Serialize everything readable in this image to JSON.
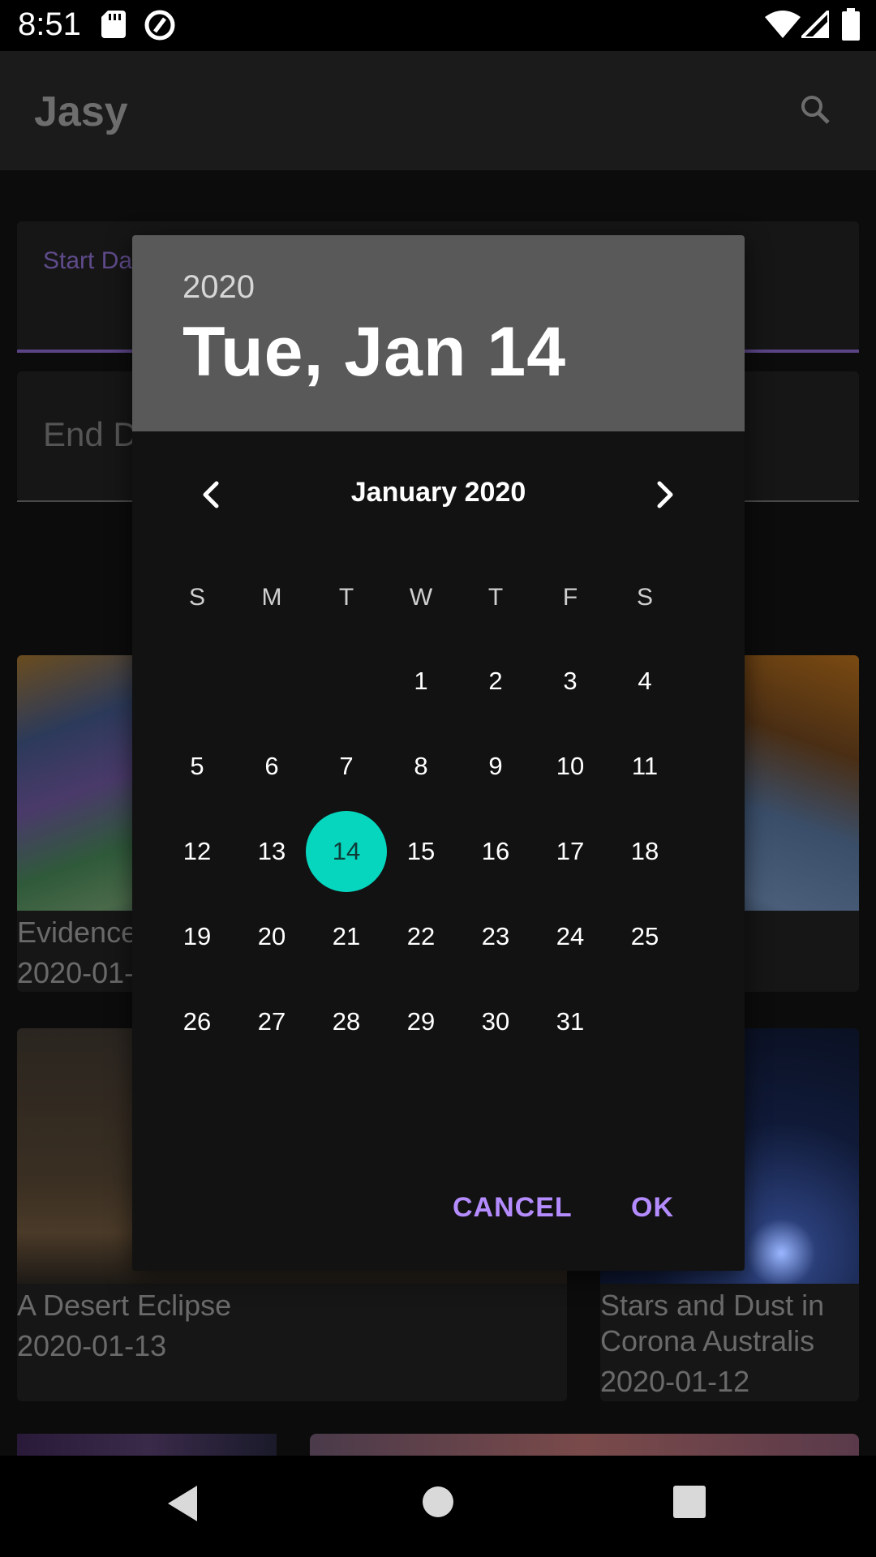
{
  "status_bar": {
    "time": "8:51",
    "icons": [
      "sd-card-icon",
      "data-saver-icon",
      "wifi-icon",
      "cell-signal-icon",
      "battery-icon"
    ]
  },
  "app_bar": {
    "title": "Jasy",
    "search_icon": "search-icon"
  },
  "background": {
    "start_date_label": "Start Da",
    "end_date_placeholder": "End D",
    "cards": [
      {
        "title": "Evidence",
        "date": "2020-01-"
      },
      {
        "title": "A Desert Eclipse",
        "date": "2020-01-13"
      },
      {
        "title": "Stars and Dust in Corona Australis",
        "title_line1": "Stars and Dust in",
        "title_line2": "Corona Australis",
        "date": "2020-01-12"
      }
    ]
  },
  "date_picker": {
    "header_year": "2020",
    "header_date": "Tue, Jan 14",
    "month_label": "January 2020",
    "prev_icon": "chevron-left-icon",
    "next_icon": "chevron-right-icon",
    "weekdays": [
      "S",
      "M",
      "T",
      "W",
      "T",
      "F",
      "S"
    ],
    "first_weekday_index": 3,
    "days_in_month": 31,
    "selected_day": 14,
    "cancel_label": "CANCEL",
    "ok_label": "OK",
    "accent_color": "#06d6be",
    "button_color": "#b58cff"
  },
  "nav_bar": {
    "icons": [
      "back-icon",
      "home-icon",
      "recents-icon"
    ]
  }
}
